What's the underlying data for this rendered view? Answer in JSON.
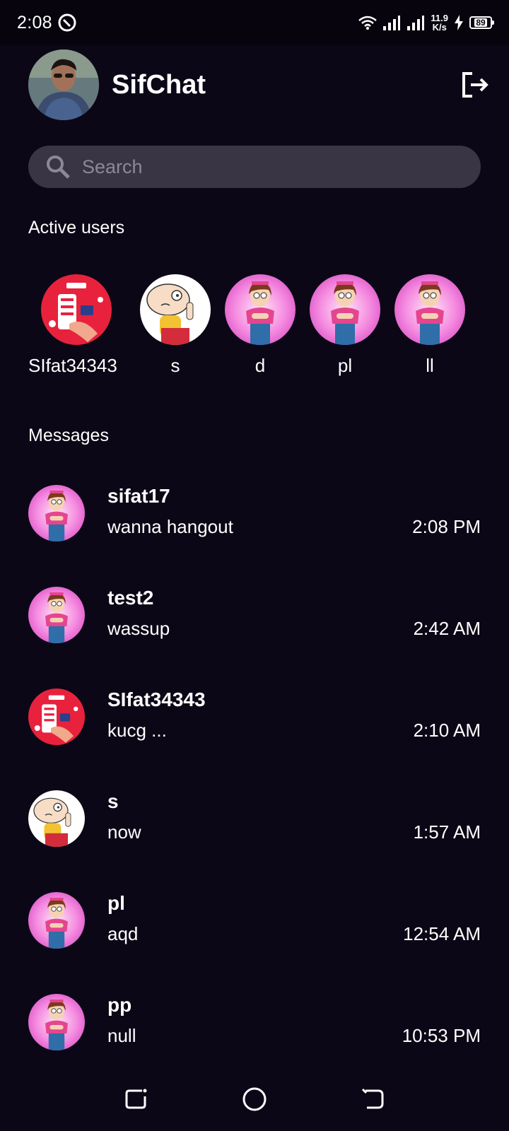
{
  "status_bar": {
    "time": "2:08",
    "net_speed_value": "11.9",
    "net_speed_unit": "K/s",
    "battery": "89"
  },
  "header": {
    "title": "SifChat"
  },
  "search": {
    "placeholder": "Search"
  },
  "active_section": {
    "title": "Active users",
    "users": [
      {
        "name": "SIfat34343",
        "avatar": "youtube-avatar"
      },
      {
        "name": "s",
        "avatar": "stewie-avatar"
      },
      {
        "name": "d",
        "avatar": "meg-avatar"
      },
      {
        "name": "pl",
        "avatar": "meg-avatar"
      },
      {
        "name": "ll",
        "avatar": "meg-avatar"
      }
    ]
  },
  "messages_section": {
    "title": "Messages",
    "items": [
      {
        "user": "sifat17",
        "text": "wanna hangout",
        "time": "2:08 PM",
        "avatar": "meg-avatar"
      },
      {
        "user": "test2",
        "text": "wassup",
        "time": "2:42 AM",
        "avatar": "meg-avatar"
      },
      {
        "user": "SIfat34343",
        "text": "kucg ...",
        "time": "2:10 AM",
        "avatar": "youtube-avatar"
      },
      {
        "user": "s",
        "text": "now",
        "time": "1:57 AM",
        "avatar": "stewie-avatar"
      },
      {
        "user": "pl",
        "text": "aqd",
        "time": "12:54 AM",
        "avatar": "meg-avatar"
      },
      {
        "user": "pp",
        "text": "null",
        "time": "10:53 PM",
        "avatar": "meg-avatar"
      }
    ]
  },
  "colors": {
    "background": "#0c0716",
    "search_bg": "#3a3545",
    "text": "#ffffff"
  }
}
